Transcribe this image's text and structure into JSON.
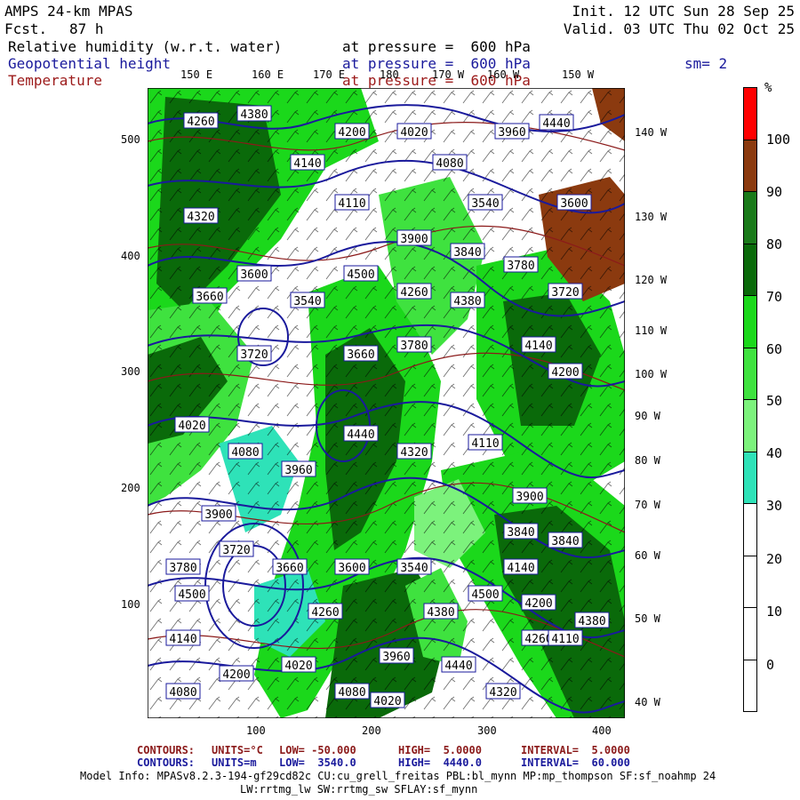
{
  "header": {
    "model": "AMPS 24-km MPAS",
    "fcst_label": "Fcst.",
    "fcst_value": "87 h",
    "init": "Init. 12 UTC Sun 28 Sep 25",
    "valid": "Valid. 03 UTC Thu 02 Oct 25",
    "fields": [
      {
        "name": "Relative humidity (w.r.t. water)",
        "level": "at pressure =  600 hPa",
        "color": "#000000"
      },
      {
        "name": "Geopotential height",
        "level": "at pressure =  600 hPa",
        "color": "#1a1a9c"
      },
      {
        "name": "Temperature",
        "level": "at pressure =  600 hPa",
        "color": "#9c1a1a"
      }
    ],
    "smooth": "sm= 2"
  },
  "map": {
    "top_lon_labels": [
      "150 E",
      "160 E",
      "170 E",
      "180",
      "170 W",
      "160 W",
      "150 W"
    ],
    "right_lon_labels": [
      "140 W",
      "130 W",
      "120 W",
      "110 W",
      "100 W",
      "90 W",
      "80 W",
      "70 W",
      "60 W",
      "50 W",
      "40 W"
    ],
    "x_ticks": [
      "100",
      "200",
      "300",
      "400"
    ],
    "y_ticks": [
      "500",
      "400",
      "300",
      "200",
      "100"
    ],
    "height_labels": [
      "4260",
      "4380",
      "4140",
      "4200",
      "4020",
      "4080",
      "3960",
      "4440",
      "4320",
      "4110",
      "3900",
      "3840",
      "3780",
      "3720",
      "3660",
      "3600",
      "3540",
      "4500"
    ],
    "colors": {
      "geopotential": "#1a1a9c",
      "temperature": "#8b1a1a",
      "wind": "#000000"
    }
  },
  "colorbar": {
    "unit": "%",
    "labels": [
      "100",
      "90",
      "80",
      "70",
      "60",
      "50",
      "40",
      "30",
      "20",
      "10",
      "0"
    ],
    "bins": [
      {
        "color": "#ff0000"
      },
      {
        "color": "#8b3a0f"
      },
      {
        "color": "#1a7a1a"
      },
      {
        "color": "#0a6a0a"
      },
      {
        "color": "#1bd81b"
      },
      {
        "color": "#3fe23f"
      },
      {
        "color": "#7cf27c"
      },
      {
        "color": "#2ee2b8"
      },
      {
        "color": "#ffffff"
      },
      {
        "color": "#ffffff"
      },
      {
        "color": "#ffffff"
      },
      {
        "color": "#ffffff"
      }
    ]
  },
  "footer": {
    "line1_label": "CONTOURS:",
    "line1_units": "UNITS=°C",
    "line1_low": "LOW= -50.000",
    "line1_high": "HIGH=  5.0000",
    "line1_interval": "INTERVAL=  5.0000",
    "line2_label": "CONTOURS:",
    "line2_units": "UNITS=m",
    "line2_low": "LOW=  3540.0",
    "line2_high": "HIGH=  4440.0",
    "line2_interval": "INTERVAL=  60.000",
    "model_info": "Model Info: MPASv8.2.3-194-gf29cd82c CU:cu_grell_freitas PBL:bl_mynn MP:mp_thompson SF:sf_noahmp 24",
    "model_info2": "LW:rrtmg_lw SW:rrtmg_sw SFLAY:sf_mynn"
  }
}
